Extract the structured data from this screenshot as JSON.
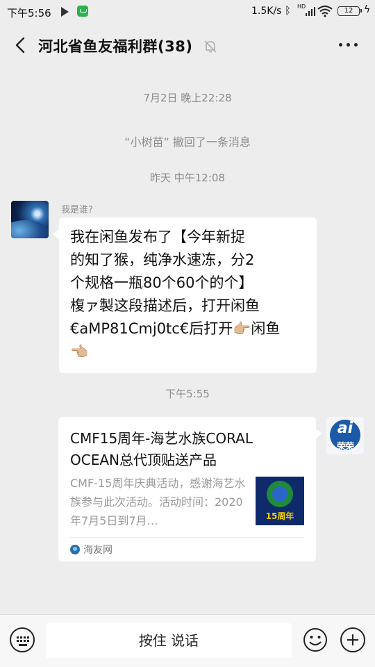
{
  "status_bar": {
    "time": "下午5:56",
    "speed": "1.5K/s",
    "network": "HD",
    "battery": "12"
  },
  "header": {
    "title": "河北省鱼友福利群(38)"
  },
  "messages": {
    "timestamp_1": "7月2日 晚上22:28",
    "recall_notice": "“小树苗” 撤回了一条消息",
    "timestamp_2": "昨天 中午12:08",
    "sender_name": "我是谁?",
    "text_message": "我在闲鱼发布了【今年新捉\n的知了猴，纯净水速冻，分2\n个规格一瓶80个60个的个】\n椱ァ製这段描述后，打开闲鱼\n€aMP81Cmj0tc€后打开👉🏼闲鱼\n👈🏼",
    "timestamp_3": "下午5:55",
    "card": {
      "title": "CMF15周年-海艺水族CORAL OCEAN总代顶贴送产品",
      "description": "CMF-15周年庆典活动，感谢海艺水族参与此次活动。活动时间：2020年7月5日到7月…",
      "thumb_label": "15周年",
      "source": "海友网"
    },
    "right_avatar_text": "ai",
    "right_avatar_word": "荣荣"
  },
  "input_bar": {
    "hold_to_talk": "按住 说话"
  }
}
